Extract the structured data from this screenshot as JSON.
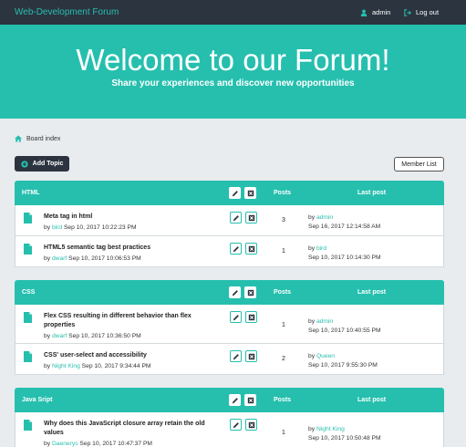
{
  "navbar": {
    "brand": "Web-Development Forum",
    "user": "admin",
    "logout": "Log out"
  },
  "hero": {
    "title": "Welcome to our Forum!",
    "subtitle": "Share your experiences and discover new opportunities"
  },
  "breadcrumb": {
    "label": "Board index"
  },
  "actions": {
    "add_topic": "Add Topic",
    "member_list": "Member List"
  },
  "colors": {
    "accent": "#26bfae",
    "navbar": "#2c3440",
    "background": "#e8ecef"
  },
  "categories": [
    {
      "name": "HTML",
      "posts_header": "Posts",
      "last_post_header": "Last post",
      "topics": [
        {
          "title": "Meta tag in html",
          "by": "by",
          "author": "bird",
          "date": "Sep 10, 2017 10:22:23 PM",
          "posts": "3",
          "last_by": "by",
          "last_author": "admin",
          "last_date": "Sep 16, 2017 12:14:58 AM"
        },
        {
          "title": "HTML5 semantic tag best practices",
          "by": "by",
          "author": "dwarf",
          "date": "Sep 10, 2017 10:06:53 PM",
          "posts": "1",
          "last_by": "by",
          "last_author": "bird",
          "last_date": "Sep 10, 2017 10:14:30 PM"
        }
      ]
    },
    {
      "name": "CSS",
      "posts_header": "Posts",
      "last_post_header": "Last post",
      "topics": [
        {
          "title": "Flex CSS resulting in different behavior than flex properties",
          "by": "by",
          "author": "dwarf",
          "date": "Sep 10, 2017 10:36:50 PM",
          "posts": "1",
          "last_by": "by",
          "last_author": "admin",
          "last_date": "Sep 10, 2017 10:40:55 PM"
        },
        {
          "title": "CSS' user-select and accessibility",
          "by": "by",
          "author": "Night King",
          "date": "Sep 10, 2017 9:34:44 PM",
          "posts": "2",
          "last_by": "by",
          "last_author": "Queen",
          "last_date": "Sep 10, 2017 9:55:30 PM"
        }
      ]
    },
    {
      "name": "Java Sript",
      "posts_header": "Posts",
      "last_post_header": "Last post",
      "topics": [
        {
          "title": "Why does this JavaScript closure array retain the old values",
          "by": "by",
          "author": "Daenerys",
          "date": "Sep 10, 2017 10:47:37 PM",
          "posts": "1",
          "last_by": "by",
          "last_author": "Night King",
          "last_date": "Sep 10, 2017 10:50:48 PM"
        }
      ]
    }
  ]
}
